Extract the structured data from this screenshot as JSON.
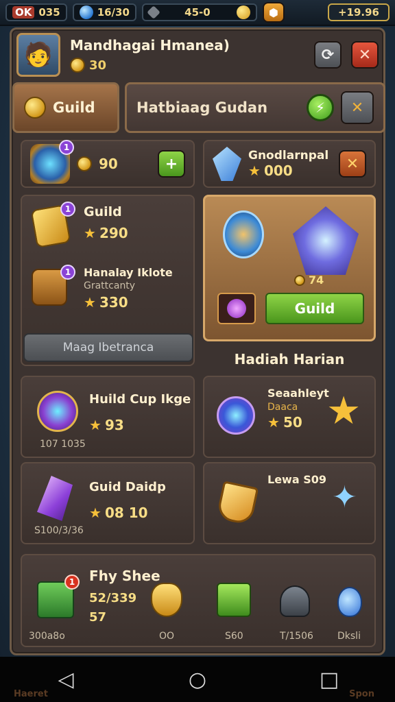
{
  "topbar": {
    "level_label": "OK",
    "level_value": "035",
    "gems": "16/30",
    "energy": "45‐0",
    "gold": "+19.96",
    "colors": {
      "gem": "#4aa3f0",
      "gold": "#f0c040",
      "badge": "#e24a3a"
    }
  },
  "profile": {
    "name": "Mandhagai Hmanea)",
    "coins": "30",
    "icons": {
      "avatar": "hero-avatar",
      "settings": "settings-icon",
      "close": "close-icon"
    }
  },
  "tabs": {
    "guild": "Guild",
    "harian": "Hatbiaag Gudan"
  },
  "cards": {
    "top_left_value": "90",
    "top_right_title": "Gnodlarnpal",
    "top_right_value": "000",
    "guild_label": "Guild",
    "guild_value": "290",
    "harian_label": "Hanalay Iklote",
    "harian_sub": "Grattcanty",
    "harian_value": "330",
    "button_disabled": "Maag Ibetranca",
    "feature_value": "74",
    "feature_button": "Guild",
    "section_title": "Hadiah Harian",
    "build_cup_label": "Huild Cup Ikge",
    "build_cup_value": "93",
    "build_cup_sub": "107 1035",
    "sealed_label": "Seaahleyt",
    "sealed_sub": "Daaca",
    "sealed_value": "50",
    "guild_raid_label": "Guid Daidp",
    "guild_raid_value": "08 10",
    "guild_raid_sub": "S100/3/36",
    "lewa_label": "Lewa S09",
    "shop_title": "Fhy Shee",
    "shop_value": "52/339",
    "shop_count": "57",
    "shop_items": [
      "300a8o",
      "OO",
      "S60",
      "T/1506",
      "Dksli"
    ]
  },
  "nav": {
    "back": "back",
    "home": "home",
    "recent": "recent",
    "ghost_left": "Haeret",
    "ghost_right": "Spon"
  }
}
